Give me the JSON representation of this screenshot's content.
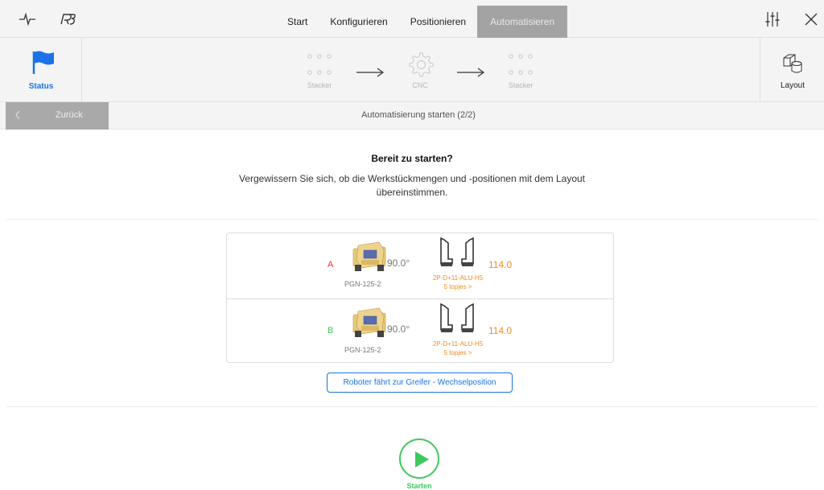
{
  "topbar": {
    "tabs": [
      {
        "label": "Start",
        "active": false
      },
      {
        "label": "Konfigurieren",
        "active": false
      },
      {
        "label": "Positionieren",
        "active": false
      },
      {
        "label": "Automatisieren",
        "active": true
      }
    ],
    "left_icons": [
      "pulse-icon",
      "robotic-logo-icon"
    ],
    "right_icons": [
      "settings-sliders-icon",
      "close-icon"
    ]
  },
  "workflow": {
    "status_label": "Status",
    "layout_label": "Layout",
    "nodes": [
      {
        "label": "Stacker",
        "icon": "dots-icon"
      },
      {
        "label": "CNC",
        "icon": "gear-icon"
      },
      {
        "label": "Stacker",
        "icon": "dots-icon"
      }
    ]
  },
  "nav": {
    "back_label": "Zurück",
    "title": "Automatisierung starten (2/2)"
  },
  "message": {
    "title": "Bereit zu starten?",
    "text": "Vergewissern Sie sich, ob die Werkstückmengen und -positionen mit dem Layout übereinstimmen."
  },
  "grippers": [
    {
      "letter": "A",
      "letter_color": "#e53935",
      "angle": "90.0°",
      "name": "PGN-125-2",
      "finger_value": "114.0",
      "finger_name": "2P-D+11-ALU-H5",
      "finger_count": "5 topjes >"
    },
    {
      "letter": "B",
      "letter_color": "#3ec95c",
      "angle": "90.0°",
      "name": "PGN-125-2",
      "finger_value": "114.0",
      "finger_name": "2P-D+11-ALU-H5",
      "finger_count": "5 topjes >"
    }
  ],
  "change_button_label": "Roboter fährt zur Greifer - Wechselposition",
  "start_label": "Starten",
  "colors": {
    "accent": "#1a73e8",
    "start_green": "#3ec95c",
    "finger_orange": "#f28c1d",
    "tab_active_bg": "#a3a3a3"
  }
}
